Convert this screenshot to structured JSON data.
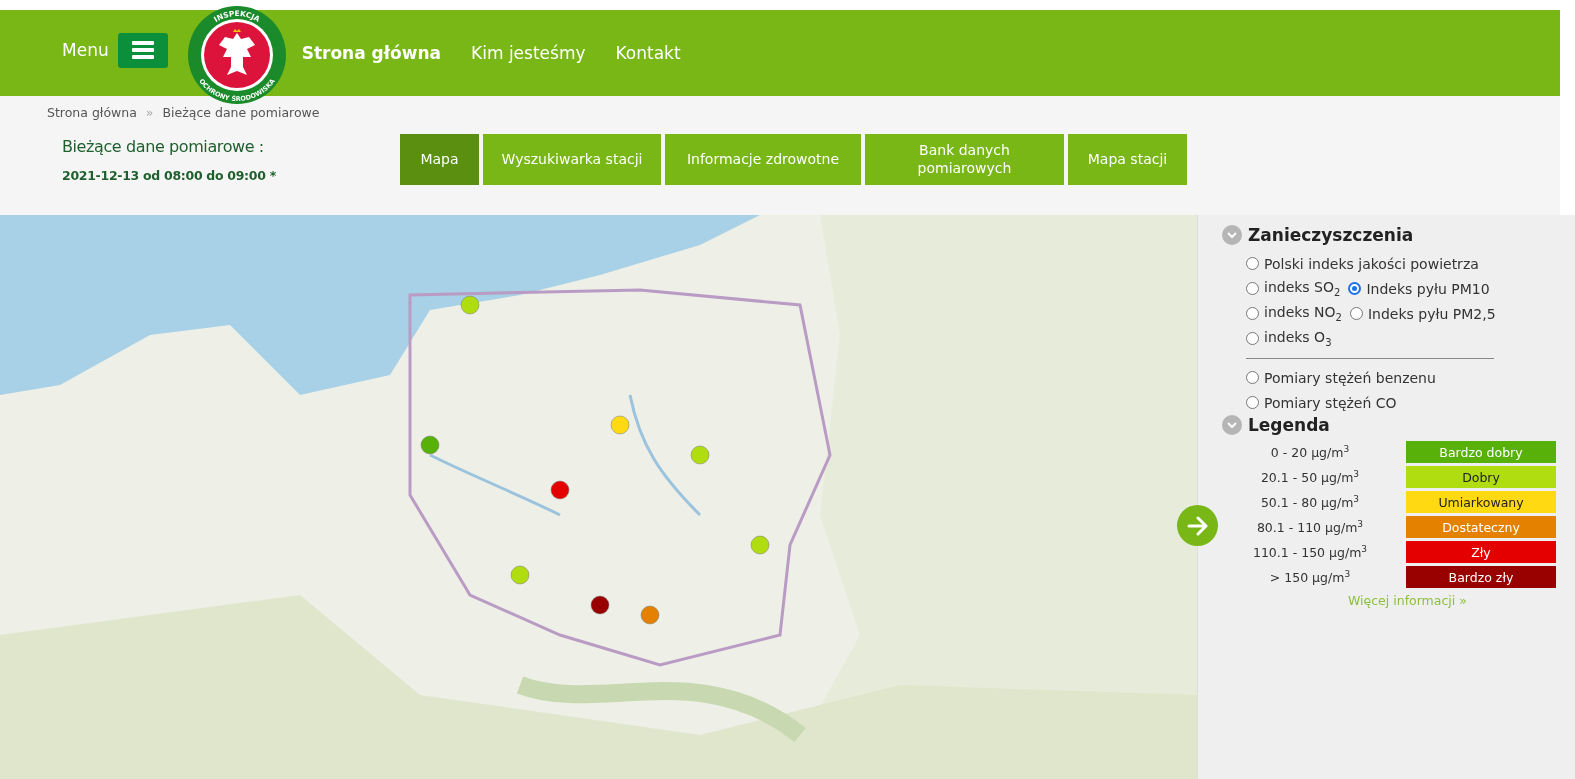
{
  "header": {
    "menu_label": "Menu",
    "logo": {
      "top_text": "INSPEKCJA",
      "bottom_text": "OCHRONY ŚRODOWISKA"
    },
    "nav": [
      {
        "label": "Strona główna",
        "selected": true
      },
      {
        "label": "Kim jesteśmy",
        "selected": false
      },
      {
        "label": "Kontakt",
        "selected": false
      }
    ]
  },
  "breadcrumb": [
    "Strona główna",
    "»",
    "Bieżące dane pomiarowe"
  ],
  "page_title": "Bieżące dane pomiarowe :",
  "date_range": "2021-12-13 od 08:00 do 09:00 *",
  "tabs": [
    {
      "label": "Mapa",
      "selected": true
    },
    {
      "label": "Wyszukiwarka stacji",
      "selected": false
    },
    {
      "label": "Informacje zdrowotne",
      "selected": false
    },
    {
      "label": "Bank danych pomiarowych",
      "selected": false
    },
    {
      "label": "Mapa stacji",
      "selected": false
    }
  ],
  "map": {
    "kind": "picture"
  },
  "panel": {
    "pollutants": {
      "title": "Zanieczyszczenia",
      "expanded": true,
      "index_rows": [
        [
          {
            "label": "Polski indeks jakości powietrza",
            "selected": false
          }
        ],
        [
          {
            "label": "indeks SO$_{2}$",
            "selected": false
          },
          {
            "label": "Indeks pyłu PM10",
            "selected": true
          }
        ],
        [
          {
            "label": "indeks NO$_{2}$",
            "selected": false
          },
          {
            "label": "Indeks pyłu PM2,5",
            "selected": false
          }
        ],
        [
          {
            "label": "indeks O$_{3}$",
            "selected": false
          }
        ]
      ],
      "measurement_rows": [
        [
          {
            "label": "Pomiary stężeń benzenu",
            "selected": false
          }
        ],
        [
          {
            "label": "Pomiary stężeń CO",
            "selected": false
          }
        ]
      ]
    },
    "legend": {
      "title": "Legenda",
      "expanded": true,
      "items": [
        {
          "range": "0 - 20 µg/m$^{3}$",
          "label": "Bardzo dobry",
          "color": "#57b108"
        },
        {
          "range": "20.1 - 50 µg/m$^{3}$",
          "label": "Dobry",
          "color": "#b0dd10"
        },
        {
          "range": "50.1 - 80 µg/m$^{3}$",
          "label": "Umiarkowany",
          "color": "#ffd911"
        },
        {
          "range": "80.1 - 110 µg/m$^{3}$",
          "label": "Dostateczny",
          "color": "#e58100"
        },
        {
          "range": "110.1 - 150 µg/m$^{3}$",
          "label": "Zły",
          "color": "#e50000"
        },
        {
          "range": "> 150 µg/m$^{3}$",
          "label": "Bardzo zły",
          "color": "#990000"
        }
      ],
      "more_link": "Więcej informacji »"
    }
  }
}
